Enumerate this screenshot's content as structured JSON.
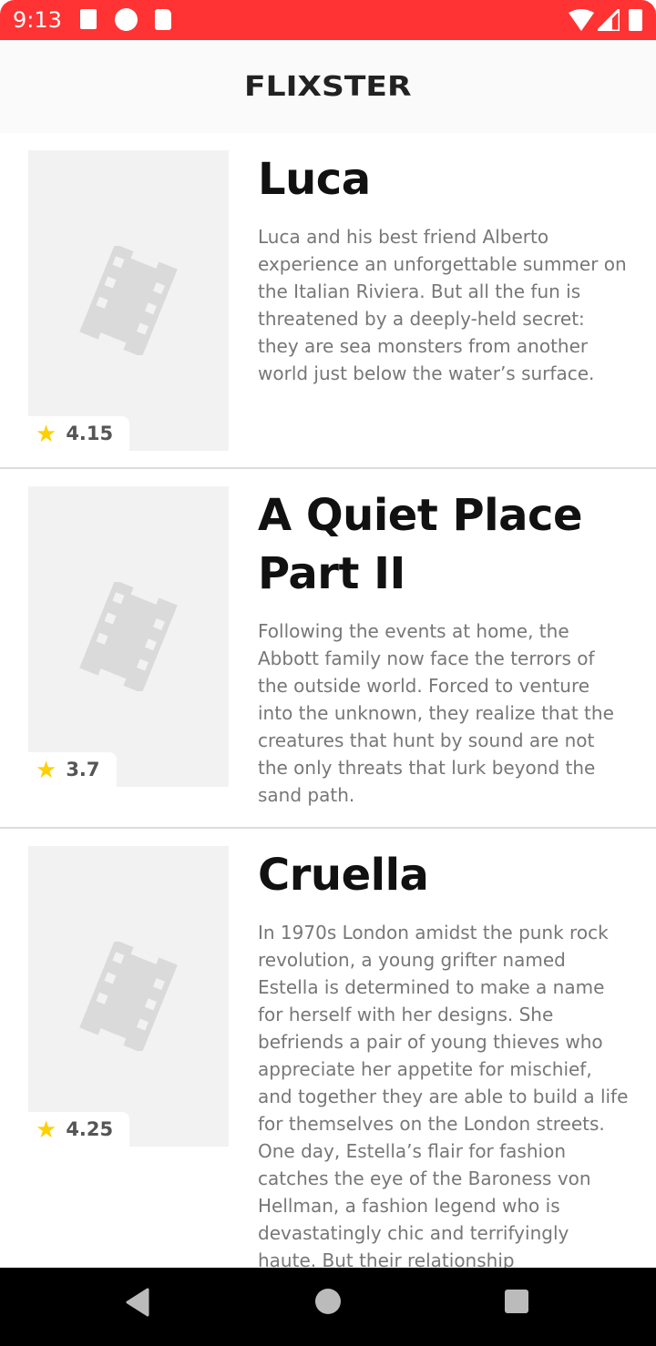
{
  "status_bar": {
    "time": "9:13"
  },
  "header": {
    "title": "FLIXSTER"
  },
  "movies": [
    {
      "title": "Luca",
      "rating": "4.15",
      "overview": "Luca and his best friend Alberto experience an unforgettable summer on the Italian Riviera. But all the fun is threatened by a deeply-held secret: they are sea monsters from another world just below the water’s surface."
    },
    {
      "title": "A Quiet Place Part II",
      "rating": "3.7",
      "overview": "Following the events at home, the Abbott family now face the terrors of the outside world. Forced to venture into the unknown, they realize that the creatures that hunt by sound are not the only threats that lurk beyond the sand path."
    },
    {
      "title": "Cruella",
      "rating": "4.25",
      "overview": "In 1970s London amidst the punk rock revolution, a young grifter named Estella is determined to make a name for herself with her designs. She befriends a pair of young thieves who appreciate her appetite for mischief, and together they are able to build a life for themselves on the London streets. One day, Estella’s flair for fashion catches the eye of the Baroness von Hellman, a fashion legend who is devastatingly chic and terrifyingly haute. But their relationship"
    }
  ]
}
